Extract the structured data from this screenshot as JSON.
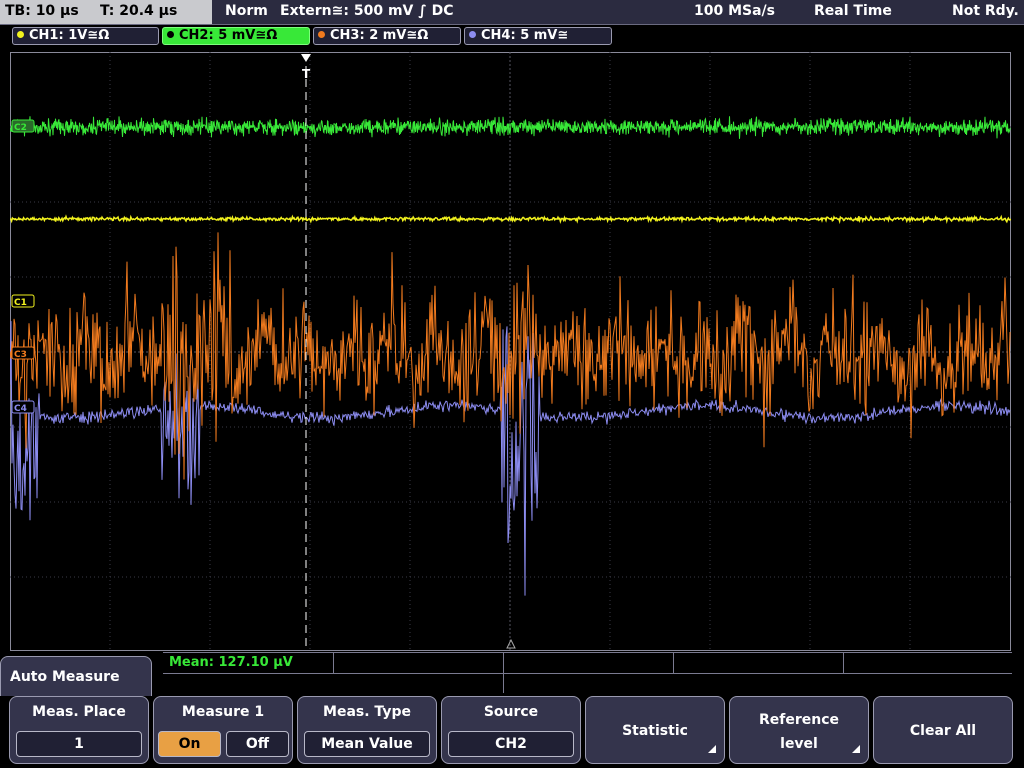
{
  "top": {
    "tb": "TB: 10 µs",
    "t": "T: 20.4 µs",
    "mode": "Norm",
    "trigger": "Extern≅: 500 mV ∫ DC",
    "sample_rate": "100 MSa/s",
    "acq": "Real Time",
    "status": "Not Rdy."
  },
  "channels": [
    {
      "label": "CH1: 1V≅Ω",
      "color": "#f2f21e"
    },
    {
      "label": "CH2: 5 mV≅Ω",
      "color": "#38e838",
      "active": true
    },
    {
      "label": "CH3: 2 mV≅Ω",
      "color": "#f07a1e"
    },
    {
      "label": "CH4: 5 mV≅",
      "color": "#8c8cf0"
    }
  ],
  "markers": {
    "c2": "C2",
    "c1": "C1",
    "c3": "C3",
    "c4": "C4",
    "trigger": "T"
  },
  "measurement": {
    "result": "Mean: 127.10 µV"
  },
  "menu": {
    "title": "Auto Measure",
    "meas_place": {
      "title": "Meas. Place",
      "value": "1"
    },
    "measure": {
      "title": "Measure 1",
      "on": "On",
      "off": "Off"
    },
    "meas_type": {
      "title": "Meas. Type",
      "value": "Mean Value"
    },
    "source": {
      "title": "Source",
      "value": "CH2"
    },
    "statistic": "Statistic",
    "reference": {
      "line1": "Reference",
      "line2": "level"
    },
    "clear": "Clear All"
  }
}
